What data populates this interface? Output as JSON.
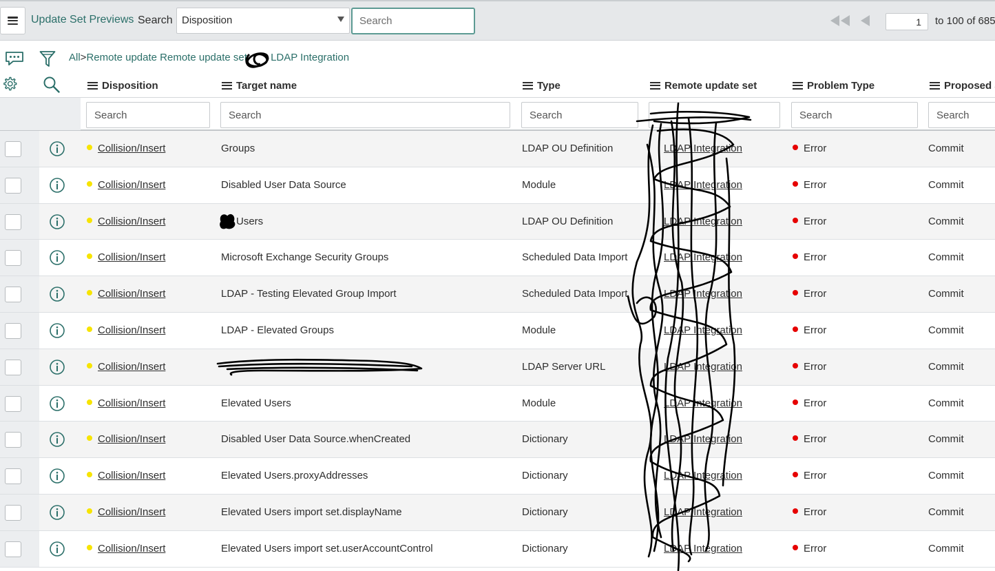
{
  "header": {
    "list_title": "Update Set Previews",
    "search_label": "Search",
    "search_field": "Disposition",
    "search_placeholder": "Search",
    "page_number": "1",
    "page_range": "to 100 of 685"
  },
  "breadcrumb": {
    "all": "All",
    "separator": ">",
    "filter_text": "Remote update Remote update set",
    "filter_value": "LDAP Integration"
  },
  "columns": [
    {
      "label": "Disposition"
    },
    {
      "label": "Target name"
    },
    {
      "label": "Type"
    },
    {
      "label": "Remote update set"
    },
    {
      "label": "Problem Type"
    },
    {
      "label": "Proposed ac"
    }
  ],
  "column_search_placeholder": "Search",
  "rows": [
    {
      "disposition": "Collision/Insert",
      "target": "Groups",
      "type": "LDAP OU Definition",
      "remote": "LDAP Integration",
      "problem": "Error",
      "proposed": "Commit"
    },
    {
      "disposition": "Collision/Insert",
      "target": "Disabled User Data Source",
      "type": "Module",
      "remote": "LDAP Integration",
      "problem": "Error",
      "proposed": "Commit"
    },
    {
      "disposition": "Collision/Insert",
      "target": "Users",
      "type": "LDAP OU Definition",
      "remote": "LDAP Integration",
      "problem": "Error",
      "proposed": "Commit"
    },
    {
      "disposition": "Collision/Insert",
      "target": "Microsoft Exchange Security Groups",
      "type": "Scheduled Data Import",
      "remote": "LDAP Integration",
      "problem": "Error",
      "proposed": "Commit"
    },
    {
      "disposition": "Collision/Insert",
      "target": "LDAP - Testing Elevated Group Import",
      "type": "Scheduled Data Import",
      "remote": "LDAP Integration",
      "problem": "Error",
      "proposed": "Commit"
    },
    {
      "disposition": "Collision/Insert",
      "target": "LDAP - Elevated Groups",
      "type": "Module",
      "remote": "LDAP Integration",
      "problem": "Error",
      "proposed": "Commit"
    },
    {
      "disposition": "Collision/Insert",
      "target": "",
      "type": "LDAP Server URL",
      "remote": "LDAP Integration",
      "problem": "Error",
      "proposed": "Commit"
    },
    {
      "disposition": "Collision/Insert",
      "target": "Elevated Users",
      "type": "Module",
      "remote": "LDAP Integration",
      "problem": "Error",
      "proposed": "Commit"
    },
    {
      "disposition": "Collision/Insert",
      "target": "Disabled User Data Source.whenCreated",
      "type": "Dictionary",
      "remote": "LDAP Integration",
      "problem": "Error",
      "proposed": "Commit"
    },
    {
      "disposition": "Collision/Insert",
      "target": "Elevated Users.proxyAddresses",
      "type": "Dictionary",
      "remote": "LDAP Integration",
      "problem": "Error",
      "proposed": "Commit"
    },
    {
      "disposition": "Collision/Insert",
      "target": "Elevated Users import set.displayName",
      "type": "Dictionary",
      "remote": "LDAP Integration",
      "problem": "Error",
      "proposed": "Commit"
    },
    {
      "disposition": "Collision/Insert",
      "target": "Elevated Users import set.userAccountControl",
      "type": "Dictionary",
      "remote": "LDAP Integration",
      "problem": "Error",
      "proposed": "Commit"
    }
  ],
  "colors": {
    "accent": "#2b6f69",
    "header_bg": "#e6e8ea",
    "disposition_dot": "#f7e400",
    "error_dot": "#e60000"
  }
}
